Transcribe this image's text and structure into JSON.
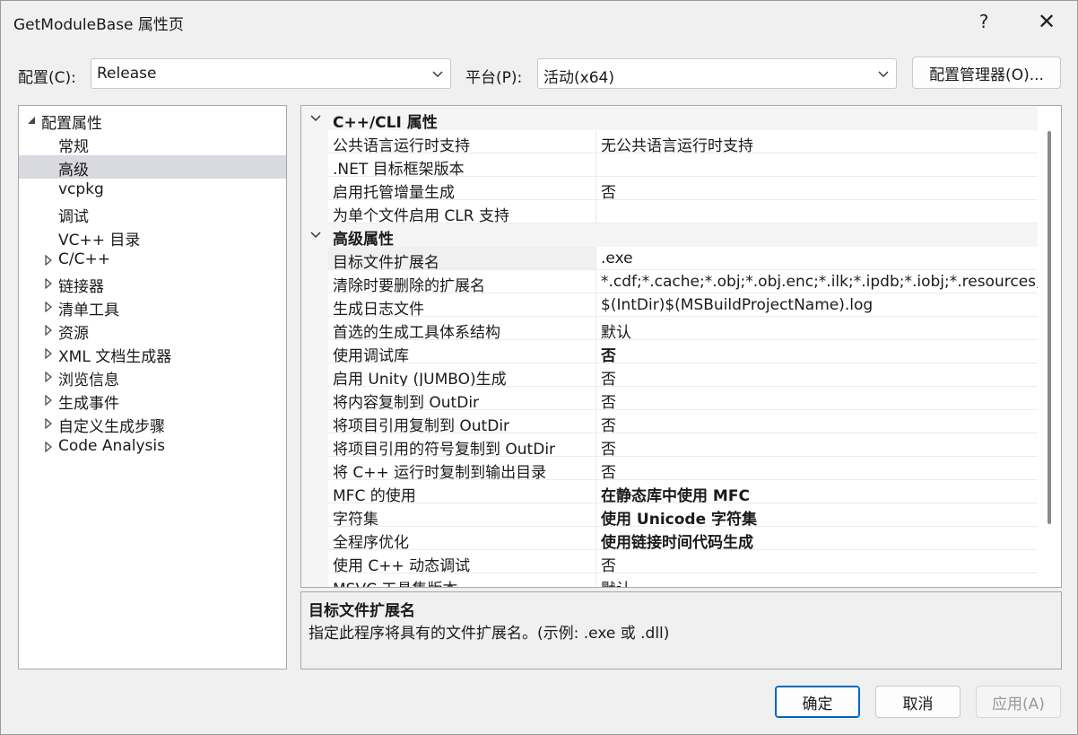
{
  "window": {
    "title": "GetModuleBase 属性页",
    "help_label": "?",
    "close_label": "✕"
  },
  "config_bar": {
    "config_label": "配置(C):",
    "config_value": "Release",
    "platform_label": "平台(P):",
    "platform_value": "活动(x64)",
    "manager_button": "配置管理器(O)..."
  },
  "tree": {
    "root": "配置属性",
    "items": [
      {
        "label": "常规",
        "expandable": false,
        "selected": false
      },
      {
        "label": "高级",
        "expandable": false,
        "selected": true
      },
      {
        "label": "vcpkg",
        "expandable": false,
        "selected": false
      },
      {
        "label": "调试",
        "expandable": false,
        "selected": false
      },
      {
        "label": "VC++ 目录",
        "expandable": false,
        "selected": false
      },
      {
        "label": "C/C++",
        "expandable": true,
        "selected": false
      },
      {
        "label": "链接器",
        "expandable": true,
        "selected": false
      },
      {
        "label": "清单工具",
        "expandable": true,
        "selected": false
      },
      {
        "label": "资源",
        "expandable": true,
        "selected": false
      },
      {
        "label": "XML 文档生成器",
        "expandable": true,
        "selected": false
      },
      {
        "label": "浏览信息",
        "expandable": true,
        "selected": false
      },
      {
        "label": "生成事件",
        "expandable": true,
        "selected": false
      },
      {
        "label": "自定义生成步骤",
        "expandable": true,
        "selected": false
      },
      {
        "label": "Code Analysis",
        "expandable": true,
        "selected": false
      }
    ]
  },
  "grid": {
    "sections": [
      {
        "title": "C++/CLI 属性",
        "rows": [
          {
            "name": "公共语言运行时支持",
            "value": "无公共语言运行时支持",
            "bold": false
          },
          {
            "name": ".NET 目标框架版本",
            "value": "",
            "bold": false
          },
          {
            "name": "启用托管增量生成",
            "value": "否",
            "bold": false
          },
          {
            "name": "为单个文件启用 CLR 支持",
            "value": "",
            "bold": false
          }
        ]
      },
      {
        "title": "高级属性",
        "rows": [
          {
            "name": "目标文件扩展名",
            "value": ".exe",
            "bold": false,
            "selected": true
          },
          {
            "name": "清除时要删除的扩展名",
            "value": "*.cdf;*.cache;*.obj;*.obj.enc;*.ilk;*.ipdb;*.iobj;*.resources;*.t",
            "bold": false
          },
          {
            "name": "生成日志文件",
            "value": "$(IntDir)$(MSBuildProjectName).log",
            "bold": false
          },
          {
            "name": "首选的生成工具体系结构",
            "value": "默认",
            "bold": false
          },
          {
            "name": "使用调试库",
            "value": "否",
            "bold": true
          },
          {
            "name": "启用 Unity (JUMBO)生成",
            "value": "否",
            "bold": false
          },
          {
            "name": "将内容复制到 OutDir",
            "value": "否",
            "bold": false
          },
          {
            "name": "将项目引用复制到 OutDir",
            "value": "否",
            "bold": false
          },
          {
            "name": "将项目引用的符号复制到 OutDir",
            "value": "否",
            "bold": false
          },
          {
            "name": "将 C++ 运行时复制到输出目录",
            "value": "否",
            "bold": false
          },
          {
            "name": "MFC 的使用",
            "value": "在静态库中使用 MFC",
            "bold": true
          },
          {
            "name": "字符集",
            "value": "使用 Unicode 字符集",
            "bold": true
          },
          {
            "name": "全程序优化",
            "value": "使用链接时间代码生成",
            "bold": true
          },
          {
            "name": "使用 C++ 动态调试",
            "value": "否",
            "bold": false
          },
          {
            "name": "MSVC 工具集版本",
            "value": "默认",
            "bold": false
          }
        ]
      }
    ]
  },
  "description": {
    "title": "目标文件扩展名",
    "text": "指定此程序将具有的文件扩展名。(示例: .exe 或 .dll)"
  },
  "buttons": {
    "ok": "确定",
    "cancel": "取消",
    "apply": "应用(A)"
  },
  "colors": {
    "accent": "#0067c0",
    "selection": "#d9d9e0",
    "background": "#f0f0f0"
  }
}
